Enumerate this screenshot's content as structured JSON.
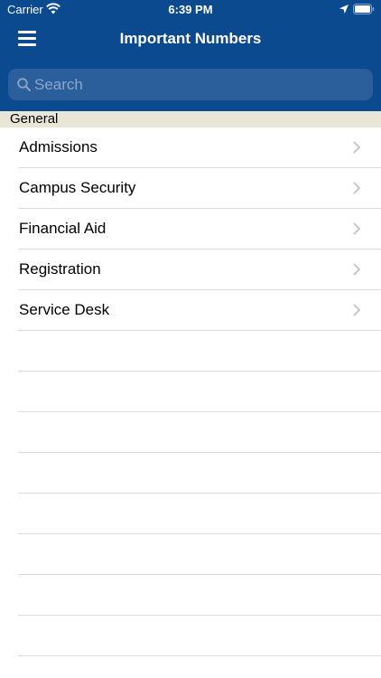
{
  "status_bar": {
    "carrier": "Carrier",
    "time": "6:39 PM",
    "icons": [
      "wifi-icon",
      "location-icon",
      "battery-icon"
    ]
  },
  "nav": {
    "title": "Important Numbers",
    "menu_icon": "menu-icon"
  },
  "search": {
    "placeholder": "Search",
    "value": ""
  },
  "section": {
    "title": "General"
  },
  "items": [
    {
      "label": "Admissions"
    },
    {
      "label": "Campus Security"
    },
    {
      "label": "Financial Aid"
    },
    {
      "label": "Registration"
    },
    {
      "label": "Service Desk"
    }
  ],
  "colors": {
    "header_bg": "#0b4a8f",
    "search_bg": "#2b5f9b",
    "section_bg": "#e9e6d8",
    "separator": "#dcdcdc",
    "chevron": "#c7c7cc"
  }
}
